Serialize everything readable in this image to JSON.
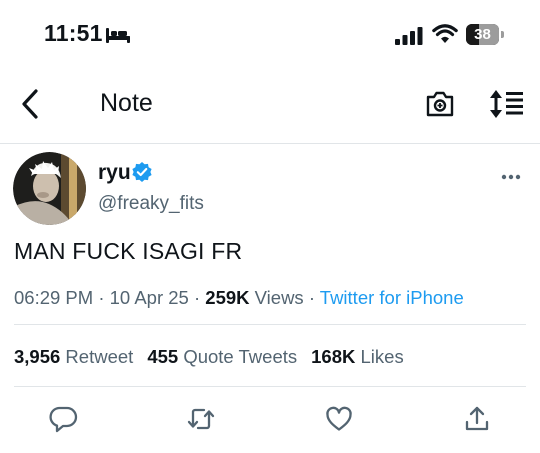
{
  "status_bar": {
    "time": "11:51",
    "sleep_icon": "bed-icon",
    "signal_icon": "cellular-signal-icon",
    "wifi_icon": "wifi-icon",
    "battery_percent": "38",
    "battery_level": 0.38
  },
  "nav": {
    "back_icon": "chevron-left-icon",
    "title": "Note",
    "camera_icon": "camera-icon",
    "sort_icon": "sort-icon"
  },
  "tweet": {
    "display_name": "ryu",
    "handle": "@freaky_fits",
    "verified": true,
    "text": "MAN FUCK ISAGI FR",
    "time": "06:29 PM",
    "sep1": " · ",
    "date": "10 Apr 25",
    "sep2": " · ",
    "views_count": "259K",
    "views_label": " Views",
    "sep3": " · ",
    "source": "Twitter for iPhone"
  },
  "stats": {
    "retweets_count": "3,956",
    "retweets_label": " Retweet",
    "quotes_count": "455",
    "quotes_label": " Quote Tweets",
    "likes_count": "168K",
    "likes_label": " Likes"
  },
  "actions": {
    "reply_icon": "reply-icon",
    "retweet_icon": "retweet-icon",
    "like_icon": "heart-icon",
    "share_icon": "share-icon"
  },
  "colors": {
    "accent": "#1d9bf0",
    "text_primary": "#0f1419",
    "text_secondary": "#536471",
    "divider": "#e1e5e8"
  }
}
